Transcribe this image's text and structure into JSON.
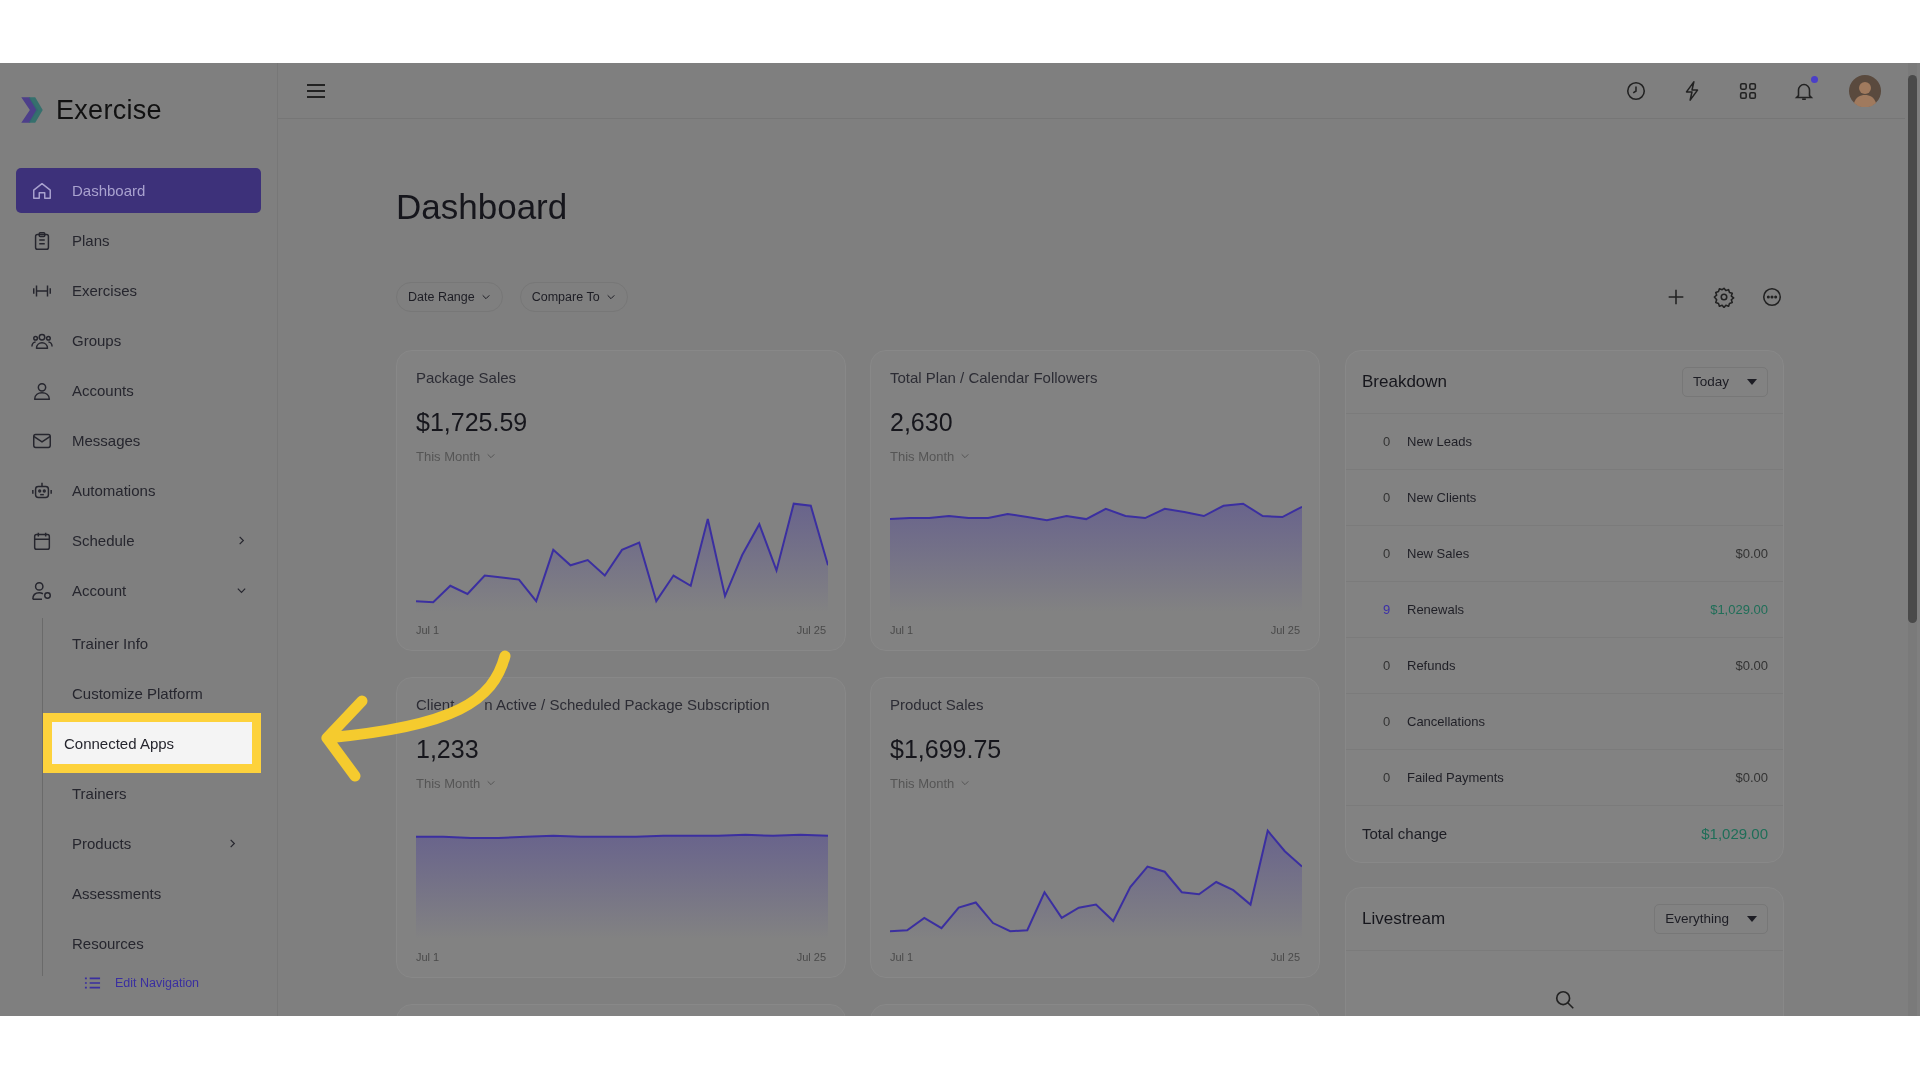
{
  "app": {
    "name": "Exercise"
  },
  "sidebar": {
    "items": [
      {
        "label": "Dashboard",
        "selected": true
      },
      {
        "label": "Plans",
        "selected": false
      },
      {
        "label": "Exercises",
        "selected": false
      },
      {
        "label": "Groups",
        "selected": false
      },
      {
        "label": "Accounts",
        "selected": false
      },
      {
        "label": "Messages",
        "selected": false
      },
      {
        "label": "Automations",
        "selected": false
      },
      {
        "label": "Schedule",
        "selected": false,
        "expanded": false
      },
      {
        "label": "Account",
        "selected": false,
        "expanded": true,
        "children": [
          {
            "label": "Trainer Info",
            "selected": false,
            "highlighted": false
          },
          {
            "label": "Customize Platform",
            "selected": false,
            "highlighted": false
          },
          {
            "label": "Connected Apps",
            "selected": false,
            "highlighted": true
          },
          {
            "label": "Trainers",
            "selected": false,
            "highlighted": false
          },
          {
            "label": "Products",
            "selected": false,
            "highlighted": false,
            "expanded": false
          },
          {
            "label": "Assessments",
            "selected": false,
            "highlighted": false
          },
          {
            "label": "Resources",
            "selected": false,
            "highlighted": false
          }
        ]
      }
    ],
    "edit_link": "Edit Navigation"
  },
  "header": {
    "notifications_unread": true
  },
  "page": {
    "title": "Dashboard",
    "filters": [
      "Date Range",
      "Compare To"
    ]
  },
  "cards": [
    {
      "title": "Package Sales",
      "value": "$1,725.59",
      "period": "This Month",
      "x_start": "Jul 1",
      "x_end": "Jul 25"
    },
    {
      "title": "Total Plan / Calendar Followers",
      "value": "2,630",
      "period": "This Month",
      "x_start": "Jul 1",
      "x_end": "Jul 25"
    },
    {
      "title": "Client",
      "title_continued": "n Active / Scheduled Package Subscription",
      "value": "1,233",
      "period": "This Month",
      "x_start": "Jul 1",
      "x_end": "Jul 25"
    },
    {
      "title": "Product Sales",
      "value": "$1,699.75",
      "period": "This Month",
      "x_start": "Jul 1",
      "x_end": "Jul 25"
    }
  ],
  "breakdown": {
    "title": "Breakdown",
    "range": "Today",
    "rows": [
      {
        "count": "0",
        "label": "New Leads",
        "positive": false
      },
      {
        "count": "0",
        "label": "New Clients",
        "positive": false
      },
      {
        "count": "0",
        "label": "New Sales",
        "amount": "$0.00",
        "positive": false
      },
      {
        "count": "9",
        "label": "Renewals",
        "amount": "$1,029.00",
        "positive": true
      },
      {
        "count": "0",
        "label": "Refunds",
        "amount": "$0.00",
        "positive": false
      },
      {
        "count": "0",
        "label": "Cancellations",
        "positive": false
      },
      {
        "count": "0",
        "label": "Failed Payments",
        "amount": "$0.00",
        "positive": false
      }
    ],
    "total": {
      "label": "Total change",
      "amount": "$1,029.00",
      "positive": true
    }
  },
  "livestream": {
    "title": "Livestream",
    "filter": "Everything"
  }
}
